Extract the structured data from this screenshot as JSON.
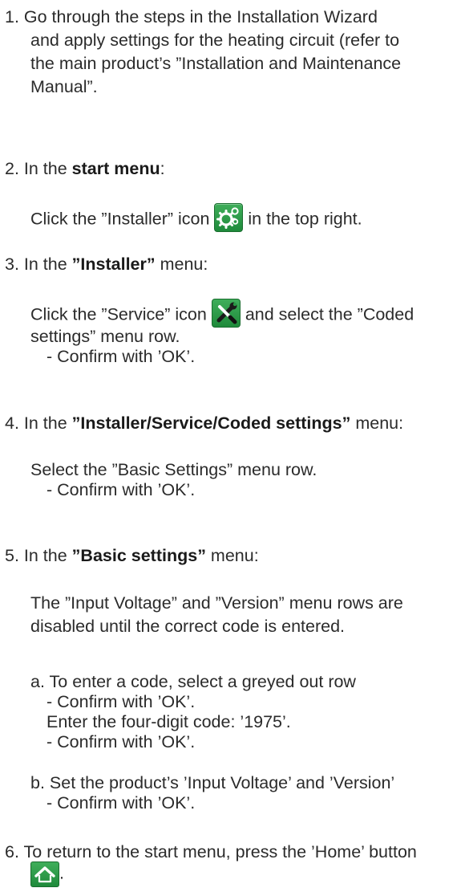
{
  "step1": {
    "line1": "1. Go through the steps in the Installation Wizard",
    "line2": "and apply settings for the heating circuit (refer to",
    "line3": "the main product’s ”Installation and Maintenance",
    "line4": "Manual”."
  },
  "step2": {
    "prefix": "2. In the ",
    "bold": "start menu",
    "suffix": ":",
    "body_before": "Click the ”Installer” icon ",
    "icon": "installer-gears-icon",
    "body_after": " in the top right."
  },
  "step3": {
    "prefix": "3. In the ",
    "bold": "”Installer”",
    "suffix": " menu:",
    "body_before": "Click the ”Service” icon ",
    "icon": "service-wrench-screwdriver-icon",
    "body_after": " and select the ”Coded",
    "body_line2": "settings” menu row.",
    "confirm": "- Confirm with ’OK’."
  },
  "step4": {
    "prefix": "4. In the ",
    "bold": "”Installer/Service/Coded settings”",
    "suffix": " menu:",
    "body": "Select the ”Basic Settings” menu row.",
    "confirm": "- Confirm with ’OK’."
  },
  "step5": {
    "prefix": "5. In the ",
    "bold": "”Basic settings”",
    "suffix": " menu:",
    "body_line1": "The ”Input Voltage” and ”Version” menu rows are",
    "body_line2": "disabled until the correct code is entered.",
    "a_line1": "a. To enter a code, select a greyed out row",
    "a_confirm1": "- Confirm with ’OK’.",
    "a_code": "Enter the four-digit code: ’1975’.",
    "a_confirm2": "- Confirm with ’OK’.",
    "b_line1": "b. Set the product’s ’Input Voltage’ and ’Version’",
    "b_confirm": "- Confirm with ’OK’."
  },
  "step6": {
    "text": "6. To return to the start menu, press the ’Home’ button",
    "icon": "home-icon",
    "period": "."
  },
  "colors": {
    "icon_green": "#2a9a45",
    "text": "#2b2b2b"
  }
}
